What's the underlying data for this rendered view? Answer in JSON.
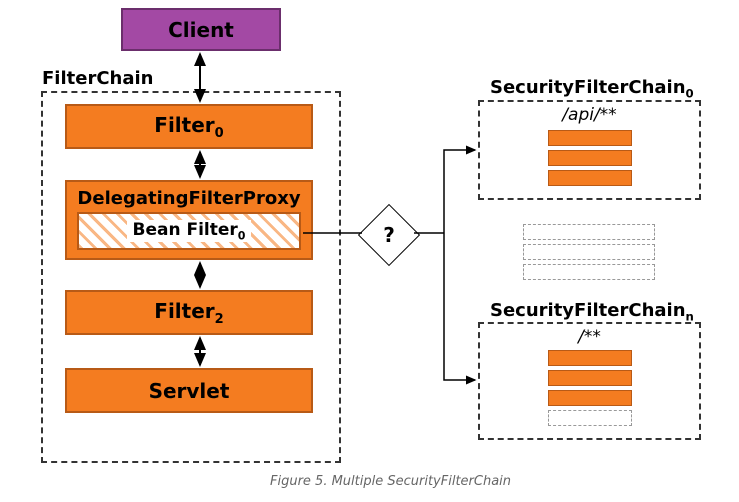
{
  "client": {
    "label": "Client"
  },
  "filterchain": {
    "label": "FilterChain"
  },
  "filters": {
    "f0": {
      "label": "Filter",
      "sub": "0"
    },
    "delegating": {
      "label": "DelegatingFilterProxy"
    },
    "bean": {
      "label": "Bean Filter",
      "sub": "0"
    },
    "f2": {
      "label": "Filter",
      "sub": "2"
    },
    "servlet": {
      "label": "Servlet"
    }
  },
  "question": {
    "label": "?"
  },
  "sfc0": {
    "label": "SecurityFilterChain",
    "sub": "0",
    "pattern": "/api/**"
  },
  "sfcn": {
    "label": "SecurityFilterChain",
    "sub": "n",
    "pattern": "/**"
  },
  "caption": "Figure 5. Multiple SecurityFilterChain"
}
